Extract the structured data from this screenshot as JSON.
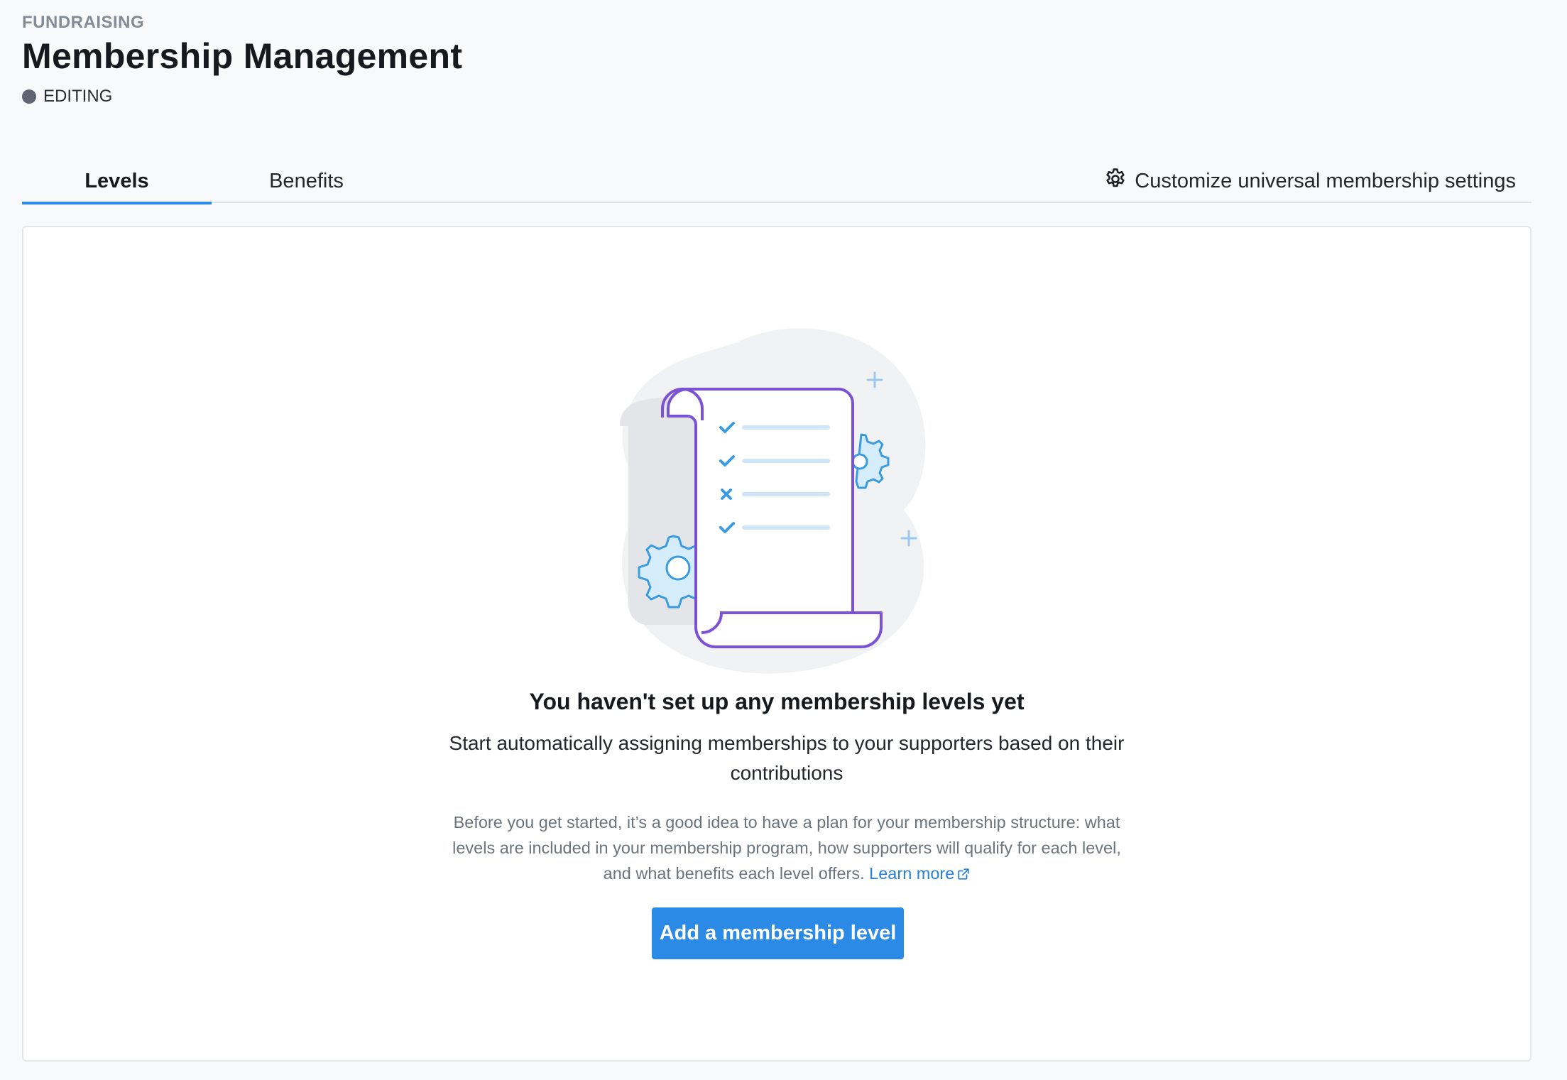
{
  "header": {
    "eyebrow": "FUNDRAISING",
    "title": "Membership Management",
    "status": "EDITING"
  },
  "tabs": [
    {
      "label": "Levels",
      "active": true
    },
    {
      "label": "Benefits",
      "active": false
    }
  ],
  "settings_link": {
    "label": "Customize universal membership settings",
    "icon": "gear-icon"
  },
  "empty_state": {
    "title": "You haven't set up any membership levels yet",
    "subtitle": "Start automatically assigning memberships to your supporters based on their contributions",
    "hint": "Before you get started, it’s a good idea to have a plan for your membership structure: what levels are included in your membership program, how supporters will qualify for each level, and what benefits each level offers.",
    "learn_more": "Learn more",
    "button_label": "Add a membership level"
  },
  "colors": {
    "accent": "#2b8ae6",
    "status_dot": "#5d6672",
    "illustration_outline": "#7b52d6"
  }
}
